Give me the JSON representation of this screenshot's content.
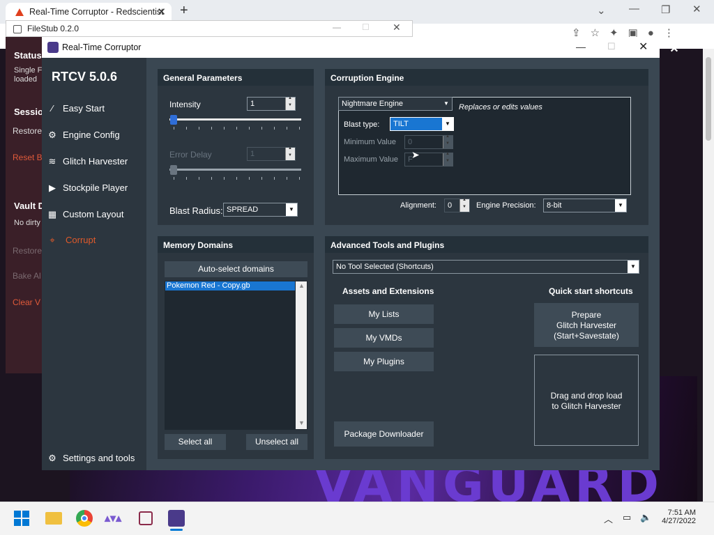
{
  "browser": {
    "tab_title": "Real-Time Corruptor - Redscientist",
    "new_tab_icon": "+",
    "close_tab_icon": "✕"
  },
  "filestub": {
    "title": "FileStub 0.2.0",
    "status_heading": "Status",
    "status_line1": "Single F",
    "status_line2": "loaded",
    "session_heading": "Sessio",
    "restore_label": "Restore",
    "reset_label": "Reset B",
    "vault_heading": "Vault D",
    "no_dirty": "No dirty",
    "restore2": "Restore",
    "bake": "Bake Al",
    "clear": "Clear V"
  },
  "rtc": {
    "window_title": "Real-Time Corruptor",
    "version": "RTCV 5.0.6",
    "nav": [
      {
        "label": "Easy Start",
        "icon": "wand-icon"
      },
      {
        "label": "Engine Config",
        "icon": "gear-icon"
      },
      {
        "label": "Glitch Harvester",
        "icon": "layers-icon"
      },
      {
        "label": "Stockpile Player",
        "icon": "play-icon"
      },
      {
        "label": "Custom Layout",
        "icon": "grid-icon"
      },
      {
        "label": "Corrupt",
        "icon": "crosshair-icon"
      }
    ],
    "settings_label": "Settings and tools"
  },
  "general": {
    "heading": "General Parameters",
    "intensity_label": "Intensity",
    "intensity_value": "1",
    "error_delay_label": "Error Delay",
    "error_delay_value": "1",
    "blast_radius_label": "Blast Radius:",
    "blast_radius_value": "SPREAD"
  },
  "engine": {
    "heading": "Corruption Engine",
    "engine_value": "Nightmare Engine",
    "engine_desc": "Replaces or edits values",
    "blast_type_label": "Blast type:",
    "blast_type_value": "TILT",
    "min_label": "Minimum Value",
    "min_value": "0",
    "max_label": "Maximum Value",
    "max_value": "F",
    "alignment_label": "Alignment:",
    "alignment_value": "0",
    "precision_label": "Engine Precision:",
    "precision_value": "8-bit"
  },
  "memory": {
    "heading": "Memory Domains",
    "auto_select": "Auto-select domains",
    "domains": [
      "Pokemon Red - Copy.gb"
    ],
    "select_all": "Select all",
    "unselect_all": "Unselect all"
  },
  "advanced": {
    "heading": "Advanced Tools and Plugins",
    "tool_select": "No Tool Selected (Shortcuts)",
    "assets_heading": "Assets and Extensions",
    "quick_heading": "Quick start shortcuts",
    "my_lists": "My Lists",
    "my_vmds": "My VMDs",
    "my_plugins": "My Plugins",
    "package_downloader": "Package Downloader",
    "prepare_line1": "Prepare",
    "prepare_line2": "Glitch Harvester",
    "prepare_line3": "(Start+Savestate)",
    "drag_line1": "Drag and drop load",
    "drag_line2": "to Glitch Harvester"
  },
  "background": {
    "banner_text": "VANGUARD"
  },
  "taskbar": {
    "time": "7:51 AM",
    "date": "4/27/2022"
  }
}
